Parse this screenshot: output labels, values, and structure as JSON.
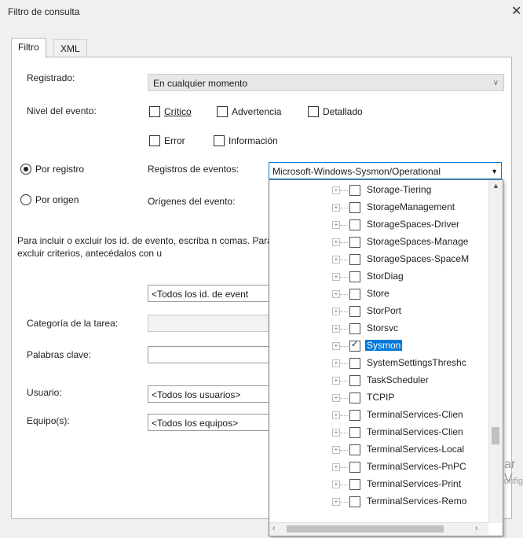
{
  "window": {
    "title": "Filtro de consulta",
    "close_glyph": "✕"
  },
  "tabs": [
    {
      "label": "Filtro"
    },
    {
      "label": "XML"
    }
  ],
  "form": {
    "registrado_label": "Registrado:",
    "registrado_value": "En cualquier momento",
    "nivel_label": "Nivel del evento:",
    "levels": [
      {
        "label": "Crítico",
        "checked": false
      },
      {
        "label": "Advertencia",
        "checked": false
      },
      {
        "label": "Detallado",
        "checked": false
      },
      {
        "label": "Error",
        "checked": false
      },
      {
        "label": "Información",
        "checked": false
      }
    ],
    "por_registro_label": "Por registro",
    "por_origen_label": "Por origen",
    "registros_label": "Registros de eventos:",
    "registros_value": "Microsoft-Windows-Sysmon/Operational",
    "origenes_label": "Orígenes del evento:",
    "description": "Para incluir o excluir los id. de evento, escriba n comas. Para excluir criterios, antecédalos con u",
    "event_ids_value": "<Todos los id. de event",
    "categoria_label": "Categoría de la tarea:",
    "palabras_label": "Palabras clave:",
    "usuario_label": "Usuario:",
    "usuario_value": "<Todos los usuarios>",
    "equipo_label": "Equipo(s):",
    "equipo_value": "<Todos los equipos>"
  },
  "dropdown": {
    "items": [
      {
        "label": "Storage-Tiering",
        "checked": false
      },
      {
        "label": "StorageManagement",
        "checked": false
      },
      {
        "label": "StorageSpaces-Driver",
        "checked": false
      },
      {
        "label": "StorageSpaces-Manage",
        "checked": false
      },
      {
        "label": "StorageSpaces-SpaceM",
        "checked": false
      },
      {
        "label": "StorDiag",
        "checked": false
      },
      {
        "label": "Store",
        "checked": false
      },
      {
        "label": "StorPort",
        "checked": false
      },
      {
        "label": "Storsvc",
        "checked": false
      },
      {
        "label": "Sysmon",
        "checked": true,
        "selected": true
      },
      {
        "label": "SystemSettingsThreshc",
        "checked": false
      },
      {
        "label": "TaskScheduler",
        "checked": false
      },
      {
        "label": "TCPIP",
        "checked": false
      },
      {
        "label": "TerminalServices-Clien",
        "checked": false
      },
      {
        "label": "TerminalServices-Clien",
        "checked": false
      },
      {
        "label": "TerminalServices-Local",
        "checked": false
      },
      {
        "label": "TerminalServices-PnPC",
        "checked": false
      },
      {
        "label": "TerminalServices-Print",
        "checked": false
      },
      {
        "label": "TerminalServices-Remo",
        "checked": false
      }
    ]
  },
  "watermark": {
    "text": "ar V",
    "subtext": "onfigu"
  },
  "colors": {
    "selection": "#0078d7"
  }
}
